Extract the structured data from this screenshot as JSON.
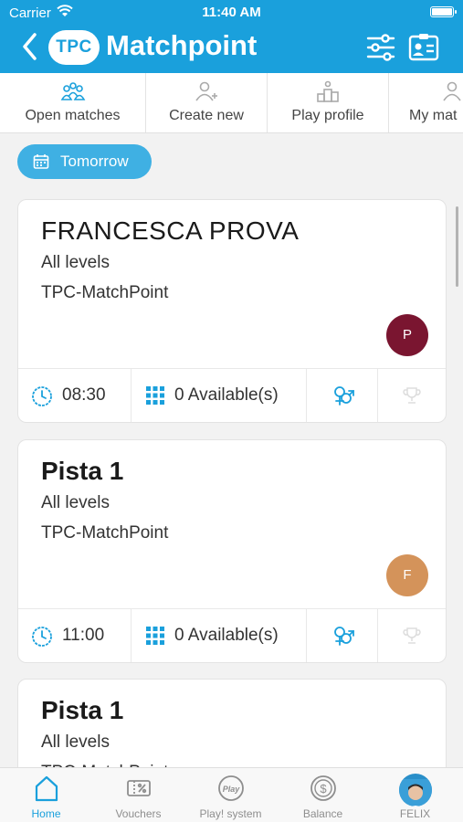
{
  "status_bar": {
    "carrier": "Carrier",
    "time": "11:40 AM"
  },
  "header": {
    "logo": "TPC",
    "title": "Matchpoint",
    "icons": [
      "back-chevron-icon",
      "filter-sliders-icon",
      "id-card-icon"
    ]
  },
  "tabs": [
    {
      "label": "Open matches",
      "icon": "group-icon"
    },
    {
      "label": "Create new",
      "icon": "add-user-icon"
    },
    {
      "label": "Play profile",
      "icon": "podium-icon"
    },
    {
      "label": "My mat",
      "icon": "user-icon"
    }
  ],
  "date_filter": {
    "label": "Tomorrow",
    "icon": "calendar-icon"
  },
  "matches": [
    {
      "name": "FRANCESCA PROVA",
      "level": "All levels",
      "club": "TPC-MatchPoint",
      "avatar_initial": "P",
      "avatar_color": "#7a1530",
      "time": "08:30",
      "available": "0 Available(s)"
    },
    {
      "name": "Pista 1",
      "level": "All levels",
      "club": "TPC-MatchPoint",
      "avatar_initial": "F",
      "avatar_color": "#d4935a",
      "time": "11:00",
      "available": "0 Available(s)"
    },
    {
      "name": "Pista 1",
      "level": "All levels",
      "club": "TPC-MatchPoint"
    }
  ],
  "bottom_nav": [
    {
      "label": "Home",
      "icon": "home-icon",
      "active": true
    },
    {
      "label": "Vouchers",
      "icon": "voucher-icon"
    },
    {
      "label": "Play! system",
      "icon": "play-system-icon"
    },
    {
      "label": "Balance",
      "icon": "balance-icon"
    },
    {
      "label": "FELIX",
      "icon": "user-avatar"
    }
  ],
  "colors": {
    "accent": "#1aa0dc",
    "pill": "#3fb0e3"
  }
}
